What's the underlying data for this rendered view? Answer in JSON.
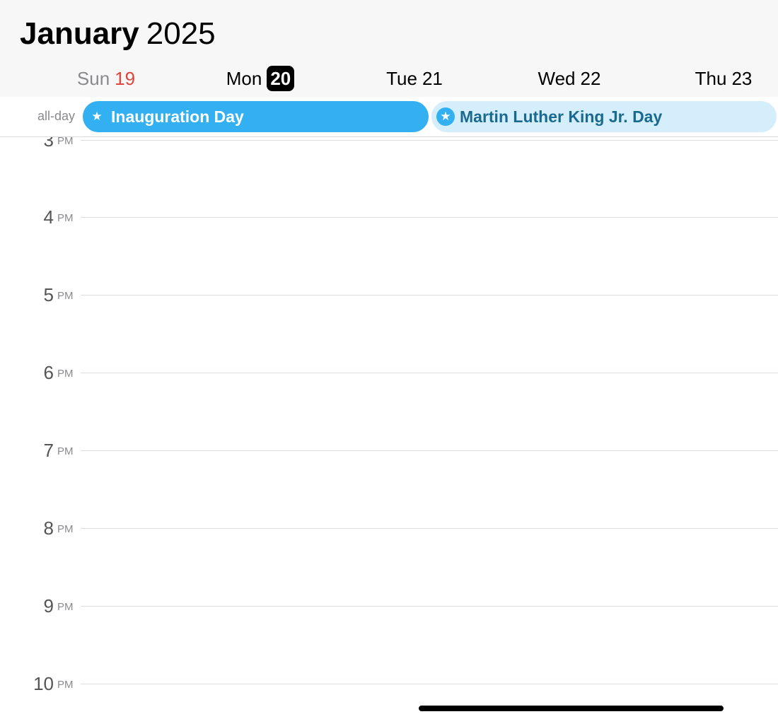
{
  "header": {
    "month": "January",
    "year": "2025"
  },
  "days": [
    {
      "name": "Sun",
      "num": "19",
      "weekend": true,
      "today": false
    },
    {
      "name": "Mon",
      "num": "20",
      "weekend": false,
      "today": true
    },
    {
      "name": "Tue",
      "num": "21",
      "weekend": false,
      "today": false
    },
    {
      "name": "Wed",
      "num": "22",
      "weekend": false,
      "today": false
    },
    {
      "name": "Thu",
      "num": "23",
      "weekend": false,
      "today": false
    }
  ],
  "allday": {
    "label": "all-day",
    "events": [
      {
        "title": "Inauguration Day",
        "icon": "star-icon",
        "color": "#32b0f2"
      },
      {
        "title": "Martin Luther King Jr. Day",
        "icon": "star-icon",
        "color": "#d4eefb"
      }
    ]
  },
  "hours": [
    {
      "num": "3",
      "suffix": "PM"
    },
    {
      "num": "4",
      "suffix": "PM"
    },
    {
      "num": "5",
      "suffix": "PM"
    },
    {
      "num": "6",
      "suffix": "PM"
    },
    {
      "num": "7",
      "suffix": "PM"
    },
    {
      "num": "8",
      "suffix": "PM"
    },
    {
      "num": "9",
      "suffix": "PM"
    },
    {
      "num": "10",
      "suffix": "PM"
    }
  ],
  "colors": {
    "accent": "#32b0f2",
    "weekend_number": "#e0443a",
    "today_badge": "#000000"
  }
}
